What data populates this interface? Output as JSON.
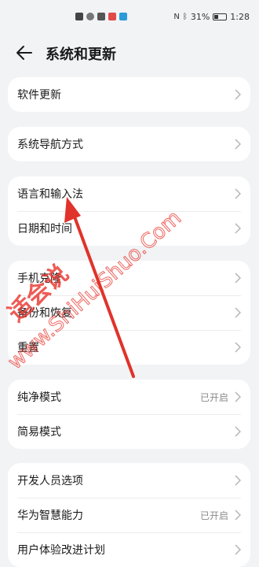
{
  "status": {
    "battery": "31%",
    "time": "1:28",
    "battery_level": 0.31
  },
  "page": {
    "title": "系统和更新"
  },
  "groups": [
    {
      "items": [
        {
          "label": "软件更新",
          "value": ""
        }
      ]
    },
    {
      "items": [
        {
          "label": "系统导航方式",
          "value": ""
        }
      ]
    },
    {
      "items": [
        {
          "label": "语言和输入法",
          "value": ""
        },
        {
          "label": "日期和时间",
          "value": ""
        }
      ]
    },
    {
      "items": [
        {
          "label": "手机克隆",
          "value": ""
        },
        {
          "label": "备份和恢复",
          "value": ""
        },
        {
          "label": "重置",
          "value": ""
        }
      ]
    },
    {
      "items": [
        {
          "label": "纯净模式",
          "value": "已开启"
        },
        {
          "label": "简易模式",
          "value": ""
        }
      ]
    },
    {
      "items": [
        {
          "label": "开发人员选项",
          "value": ""
        },
        {
          "label": "华为智慧能力",
          "value": "已开启"
        },
        {
          "label": "用户体验改进计划",
          "value": ""
        }
      ]
    }
  ],
  "watermark": {
    "text1": "适会说",
    "text2": "www.ShiHuiShuo.Com",
    "color": "#e8322a"
  },
  "colors": {
    "background": "#f1f3f5",
    "card": "#ffffff",
    "arrow": "#e0332b"
  }
}
